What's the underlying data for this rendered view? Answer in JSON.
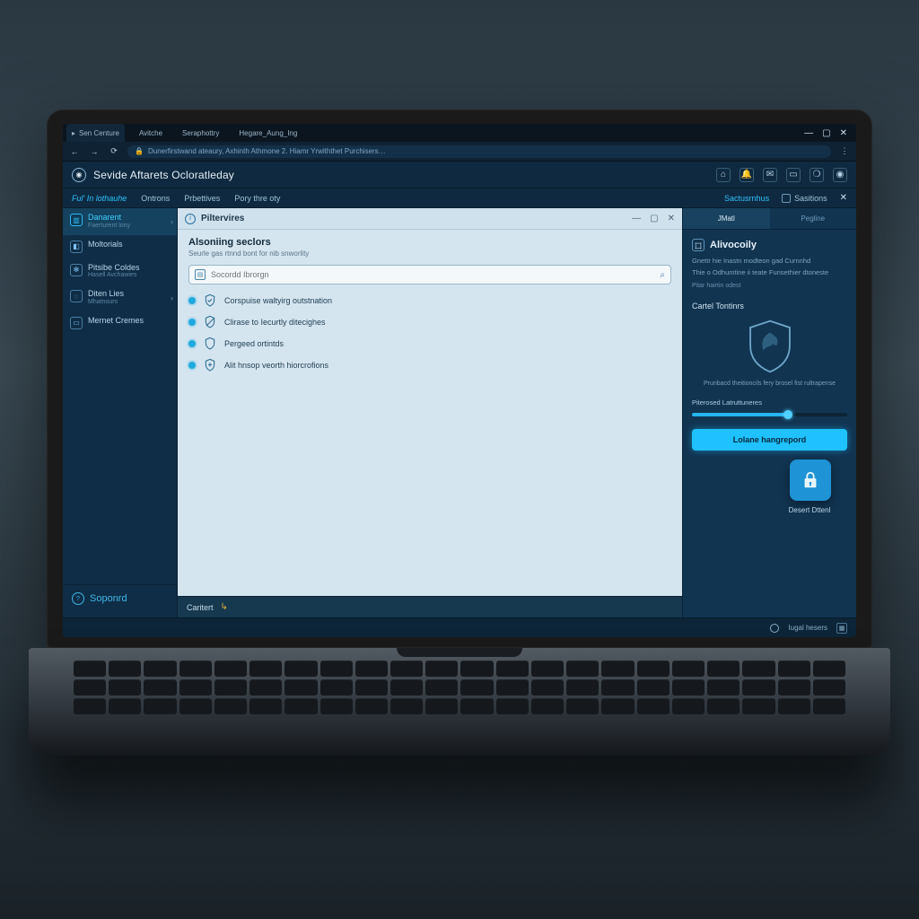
{
  "window": {
    "tabs": [
      {
        "label": "Sen Centure",
        "active": true
      },
      {
        "label": "Avitche"
      },
      {
        "label": "Seraphottry"
      },
      {
        "label": "Hegare_Aung_Ing"
      }
    ],
    "controls": {
      "min": "—",
      "max": "▢",
      "close": "✕"
    }
  },
  "address": {
    "back": "←",
    "fwd": "→",
    "reload": "⟳",
    "lock_text": "Dunerfirstwand ateaury, Axhinth Athmone 2. Hiamr Yrwiththet Purchisers…"
  },
  "header": {
    "title": "Sevide Aftarets Ocloratleday",
    "icons": [
      "⌂",
      "🔔",
      "✉",
      "▭",
      "❍",
      "◉"
    ]
  },
  "topnav": {
    "items": [
      "Ful' In lothauhe",
      "Ontrons",
      "Prbettives",
      "Pory thre oty"
    ],
    "session_link": "Sactusrnhus",
    "sessions_label": "Sasitions"
  },
  "sidebar": {
    "items": [
      {
        "icon": "▥",
        "label": "Danarent",
        "sub": "Faerturent lony",
        "active": true,
        "chev": true
      },
      {
        "icon": "◧",
        "label": "Moltorials"
      },
      {
        "icon": "✻",
        "label": "Pitsibe Coldes",
        "sub": "Hasell Avchawies"
      },
      {
        "icon": "◌",
        "label": "Diten Lies",
        "sub": "Mhatnours",
        "chev": true
      },
      {
        "icon": "▭",
        "label": "Mernet Cremes"
      }
    ],
    "footer": "Soponrd"
  },
  "panel": {
    "title": "Piltervires",
    "section_title": "Alsoniing seclors",
    "section_sub": "Seurle gas rtnnd bont for nib snworlity",
    "search_placeholder": "Socordd Ibrorgn",
    "options": [
      {
        "icon": "shield-check",
        "label": "Corspuise waltyirg outstnation"
      },
      {
        "icon": "shield-slash",
        "label": "Clirase to Iecurtly ditecighes"
      },
      {
        "icon": "shield-outline",
        "label": "Pergeed ortintds"
      },
      {
        "icon": "shield-plus",
        "label": "Alit hnsop veorth hiorcrofions"
      }
    ],
    "footer_label": "Caritert"
  },
  "right": {
    "tabs": [
      {
        "label": "JMatl",
        "active": true
      },
      {
        "label": "Pegline"
      }
    ],
    "title": "Alivocoily",
    "desc1": "Gnettr hie Inastn modteon gad Curnnhd",
    "desc2": "Thie o Odhumtine ii teate Funsethier dtoneste",
    "desc3": "Pitar hairtin odest",
    "functions_label": "Cartel Tontinrs",
    "lock_caption": "Desert Dttenl",
    "shield_desc": "Prunbacd theitioncils fery brosel fist rultrapense",
    "slider_label": "Piterosed Latruttuneres",
    "slider_pct": 62,
    "button": "Lolane hangrepord"
  },
  "status": {
    "right_text": "Iugal hesers"
  },
  "colors": {
    "accent": "#1fc2ff",
    "bg_dark": "#0f2a40",
    "panel_light": "#d5e5ef"
  }
}
